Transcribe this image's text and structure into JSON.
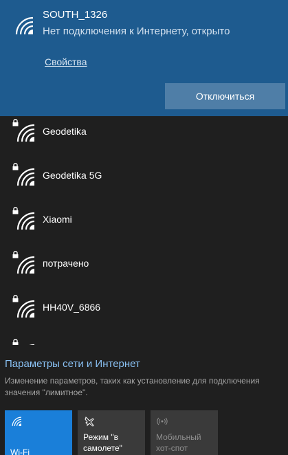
{
  "connected": {
    "ssid": "SOUTH_1326",
    "status": "Нет подключения к Интернету, открыто",
    "properties_link": "Свойства",
    "disconnect_button": "Отключиться",
    "icon": "wifi-signal-icon"
  },
  "networks": [
    {
      "name": "Geodetika",
      "secured": true,
      "icon": "wifi-secured-icon"
    },
    {
      "name": "Geodetika 5G",
      "secured": true,
      "icon": "wifi-secured-icon"
    },
    {
      "name": "Xiaomi",
      "secured": true,
      "icon": "wifi-secured-icon"
    },
    {
      "name": "потрачено",
      "secured": true,
      "icon": "wifi-secured-icon"
    },
    {
      "name": "HH40V_6866",
      "secured": true,
      "icon": "wifi-secured-icon"
    }
  ],
  "settings": {
    "link": "Параметры сети и Интернет",
    "description": "Изменение параметров, таких как установление для подключения значения \"лимитное\"."
  },
  "quick_actions": [
    {
      "label": "Wi-Fi",
      "state": "on",
      "icon": "wifi-icon"
    },
    {
      "label": "Режим \"в самолете\"",
      "state": "off",
      "icon": "airplane-icon"
    },
    {
      "label": "Мобильный хот-спот",
      "state": "disabled",
      "icon": "hotspot-icon"
    }
  ],
  "colors": {
    "connected_bg": "#1e5b8f",
    "list_bg": "#1f1f1f",
    "accent": "#1a7fd9",
    "link": "#8ac2f5"
  }
}
